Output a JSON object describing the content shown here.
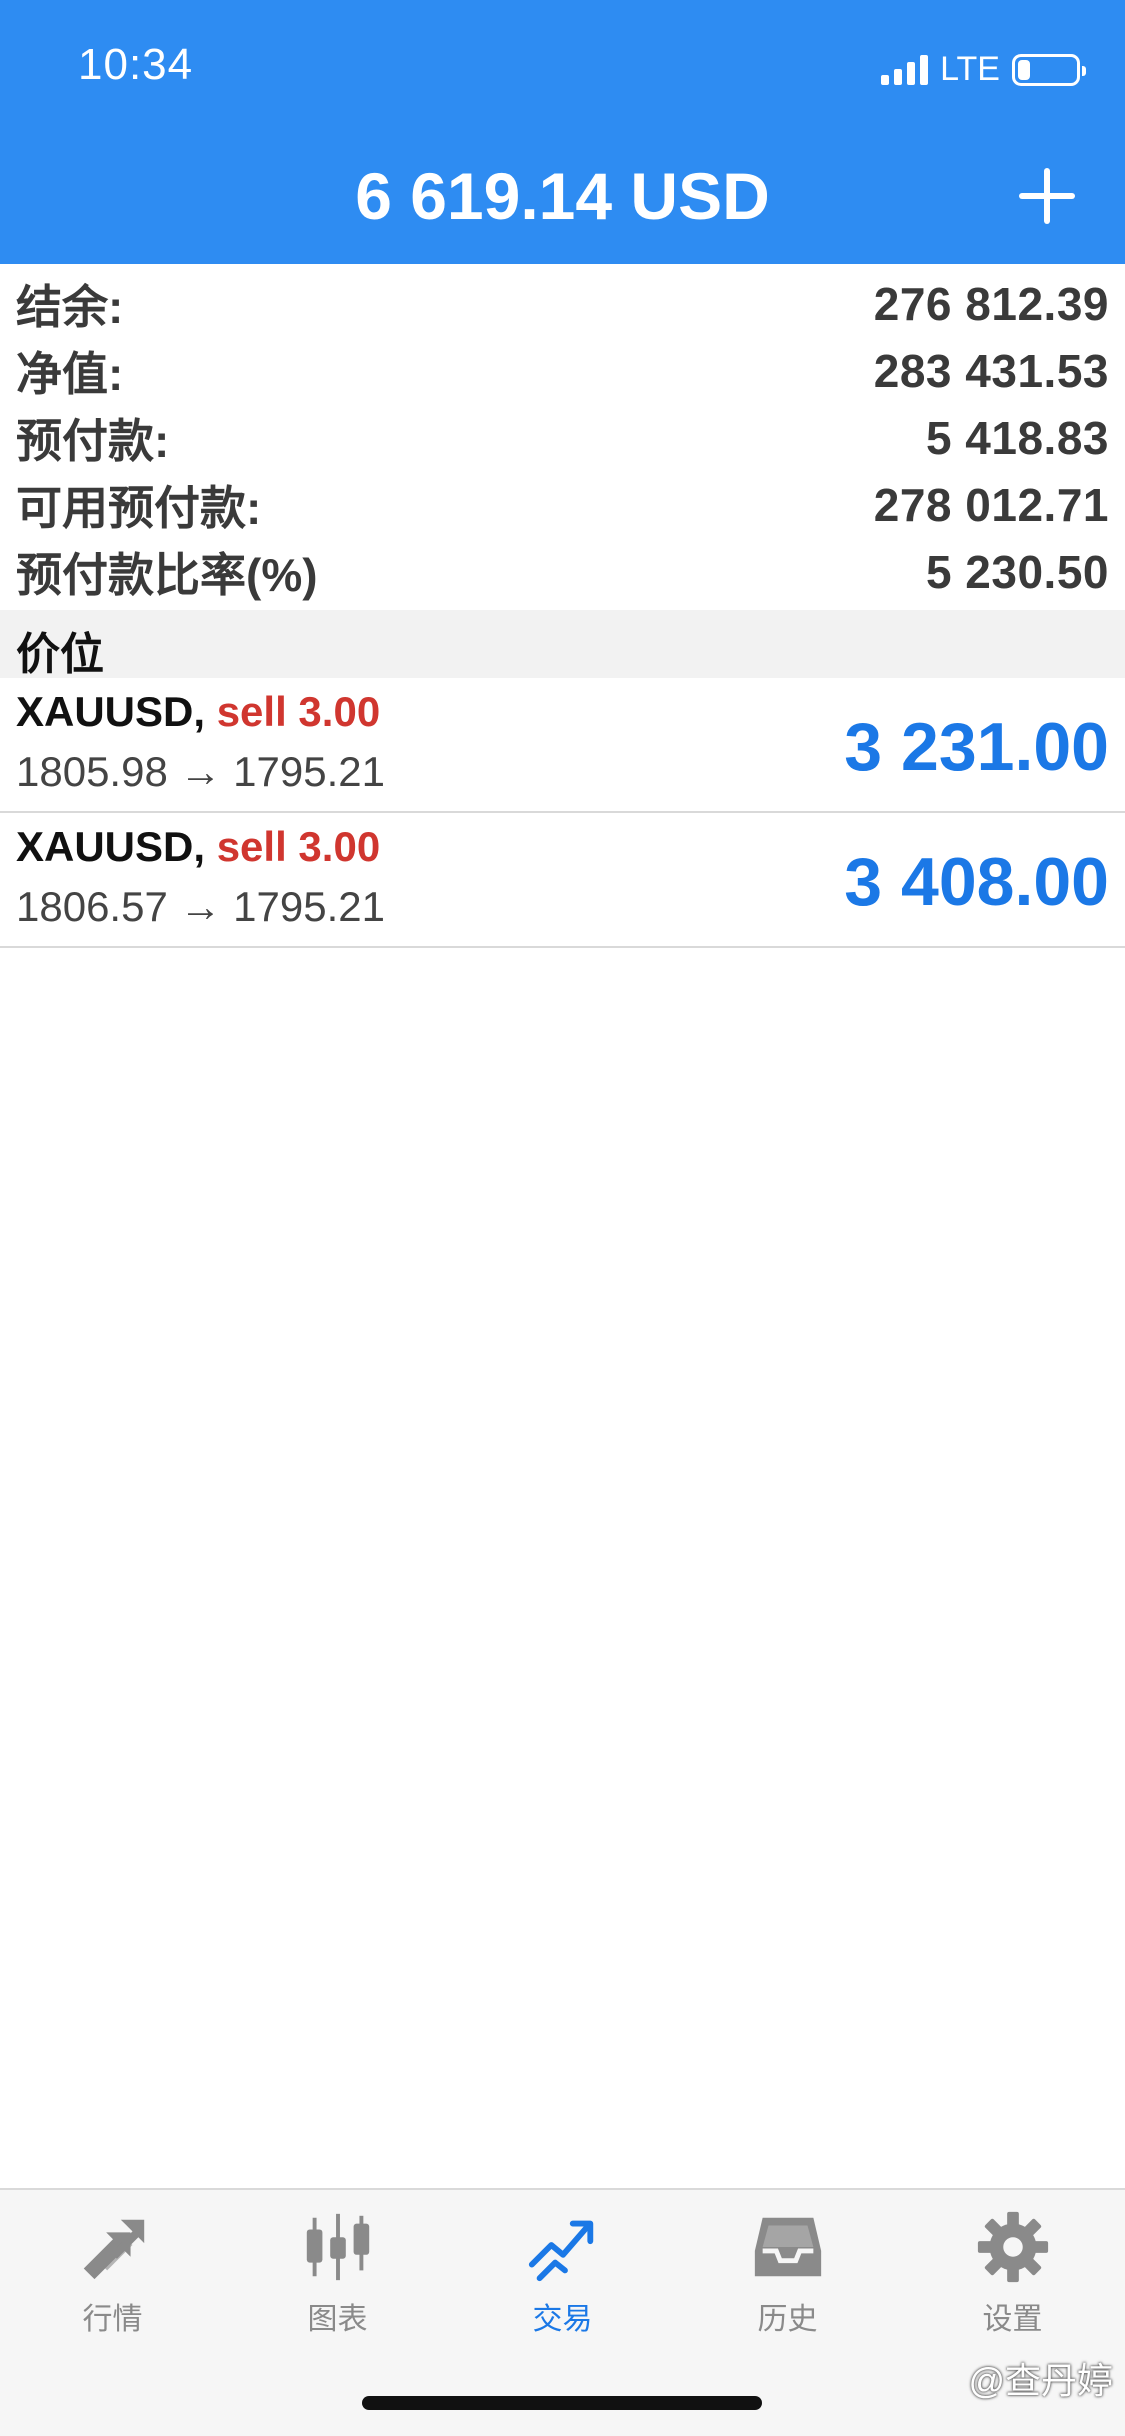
{
  "status": {
    "time": "10:34",
    "network": "LTE"
  },
  "header": {
    "balance": "6 619.14 USD"
  },
  "summary": [
    {
      "label": "结余:",
      "value": "276 812.39"
    },
    {
      "label": "净值:",
      "value": "283 431.53"
    },
    {
      "label": "预付款:",
      "value": "5 418.83"
    },
    {
      "label": "可用预付款:",
      "value": "278 012.71"
    },
    {
      "label": "预付款比率(%)",
      "value": "5 230.50"
    }
  ],
  "section": {
    "title": "价位"
  },
  "positions": [
    {
      "symbol": "XAUUSD,",
      "side": "sell 3.00",
      "prices": "1805.98 → 1795.21",
      "profit": "3 231.00"
    },
    {
      "symbol": "XAUUSD,",
      "side": "sell 3.00",
      "prices": "1806.57 → 1795.21",
      "profit": "3 408.00"
    }
  ],
  "tabs": [
    {
      "label": "行情",
      "icon": "quotes-arrows-icon"
    },
    {
      "label": "图表",
      "icon": "candlestick-icon"
    },
    {
      "label": "交易",
      "icon": "trade-trend-icon"
    },
    {
      "label": "历史",
      "icon": "inbox-tray-icon"
    },
    {
      "label": "设置",
      "icon": "gear-icon"
    }
  ],
  "watermark": "@查丹婷",
  "colors": {
    "header": "#2e8cf2",
    "accent": "#1b78e6",
    "sell": "#d0362f"
  }
}
